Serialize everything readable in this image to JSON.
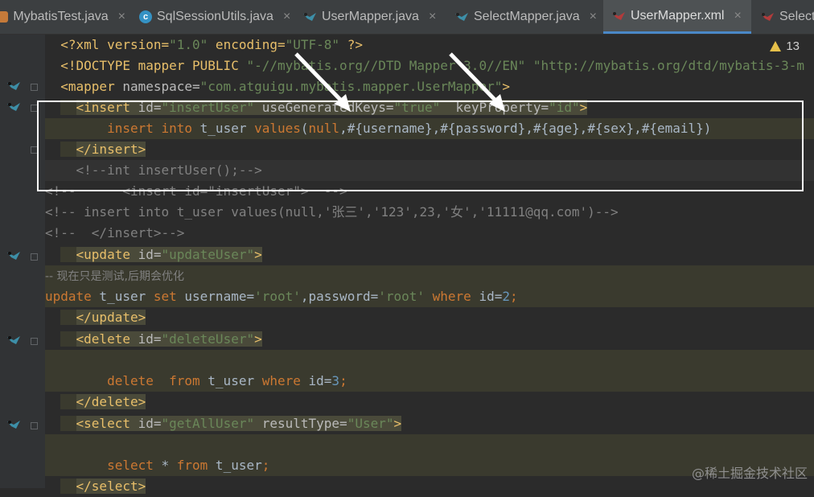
{
  "tabs": [
    {
      "label": "MybatisTest.java",
      "icon": "java-class-icon"
    },
    {
      "label": "SqlSessionUtils.java",
      "icon": "class-c-icon"
    },
    {
      "label": "UserMapper.java",
      "icon": "mybatis-mapper-icon"
    },
    {
      "label": "SelectMapper.java",
      "icon": "mybatis-mapper-icon"
    },
    {
      "label": "UserMapper.xml",
      "icon": "mybatis-xml-icon",
      "active": true
    },
    {
      "label": "Select",
      "icon": "mybatis-xml-icon"
    }
  ],
  "close_glyph": "×",
  "warnings": {
    "count": "13"
  },
  "watermark": "@稀土掘金技术社区",
  "colors": {
    "accent": "#4a88c7",
    "tag": "#e8bf6a",
    "string": "#6a8759",
    "keyword": "#cc7832",
    "comment": "#808080"
  },
  "code": {
    "l1": {
      "a": "<?xml version=",
      "b": "\"1.0\"",
      "c": " encoding=",
      "d": "\"UTF-8\"",
      "e": " ?>"
    },
    "l2": {
      "a": "<!DOCTYPE mapper PUBLIC ",
      "b": "\"-//mybatis.org//DTD Mapper 3.0//EN\"",
      "c": " ",
      "d": "\"http://mybatis.org/dtd/mybatis-3-m"
    },
    "l3": {
      "a": "<mapper ",
      "b": "namespace=",
      "c": "\"com.atguigu.mybatis.mapper.UserMapper\"",
      "d": ">"
    },
    "l4": {
      "a": "<insert ",
      "b": "id=",
      "c": "\"insertUser\"",
      "d": " useGeneratedKeys=",
      "e": "\"true\"",
      "f": "  keyProperty=",
      "g": "\"id\"",
      "h": ">"
    },
    "l5": {
      "a": "insert into",
      "b": " t_user ",
      "c": "values",
      "d": "(",
      "e": "null",
      "f": ",#{username},#{password},#{age},#{sex},#{email})"
    },
    "l6": {
      "a": "</insert>"
    },
    "l7": {
      "a": "<!--int insertUser();-->"
    },
    "l8": {
      "a": "<!--      <insert id=\"insertUser\">  -->"
    },
    "l9": {
      "a": "<!-- insert into t_user values(null,'张三','123',23,'女','11111@qq.com')-->"
    },
    "l10": {
      "a": "<!--  </insert>-->"
    },
    "l11": {
      "a": "<update ",
      "b": "id=",
      "c": "\"updateUser\"",
      "d": ">"
    },
    "l12": {
      "a": "-- 现在只是测试,后期会优化"
    },
    "l13": {
      "a": "update",
      "b": " t_user ",
      "c": "set",
      "d": " username=",
      "e": "'root'",
      "f": ",password=",
      "g": "'root'",
      "h": " where ",
      "i": "id=",
      "j": "2",
      "k": ";"
    },
    "l14": {
      "a": "</update>"
    },
    "l15": {
      "a": "<delete ",
      "b": "id=",
      "c": "\"deleteUser\"",
      "d": ">"
    },
    "l16": {
      "a": "delete  from",
      "b": " t_user ",
      "c": "where",
      "d": " id=",
      "e": "3",
      "f": ";"
    },
    "l17": {
      "a": "</delete>"
    },
    "l18": {
      "a": "<select ",
      "b": "id=",
      "c": "\"getAllUser\"",
      "d": " resultType=",
      "e": "\"User\"",
      "f": ">"
    },
    "l19": {
      "a": "select",
      "b": " * ",
      "c": "from",
      "d": " t_user",
      "e": ";"
    },
    "l20": {
      "a": "</select>"
    }
  }
}
